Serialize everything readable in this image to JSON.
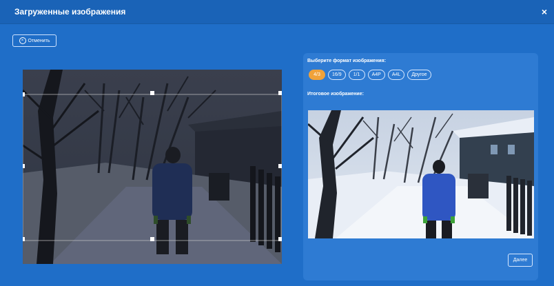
{
  "window": {
    "title": "Загруженные изображения",
    "close_label": "×"
  },
  "toolbar": {
    "cancel_label": "Отменить",
    "cancel_icon": "close-circle-icon"
  },
  "panel": {
    "format_heading": "Выберите формат изображения:",
    "formats": [
      "4/3",
      "16/9",
      "1/1",
      "A4P",
      "A4L",
      "Другое"
    ],
    "selected_format": "4/3",
    "result_heading": "Итоговое изображение:",
    "next_label": "Далее"
  },
  "colors": {
    "background": "#1f6ec8",
    "titlebar": "#1a63b7",
    "panel": "#2e7bd3",
    "accent": "#f0a23a"
  }
}
